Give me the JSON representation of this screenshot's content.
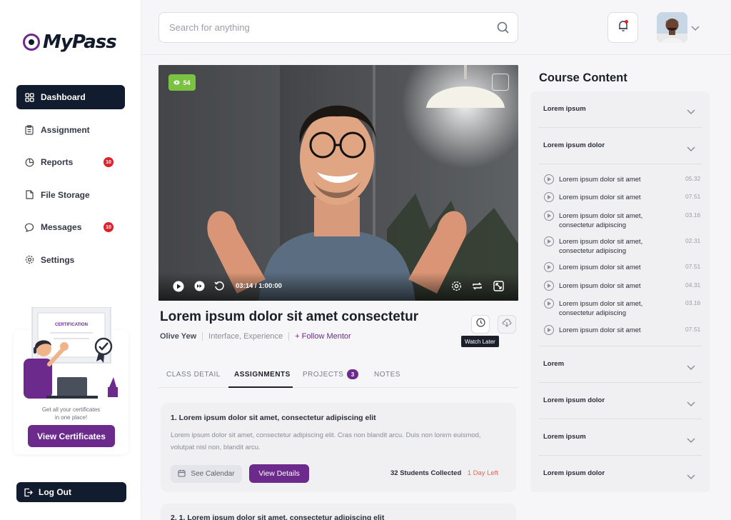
{
  "brand": {
    "name_prefix": "My",
    "name_suffix": "Pass"
  },
  "nav": {
    "items": [
      {
        "label": "Dashboard",
        "icon": "grid-icon",
        "badge": ""
      },
      {
        "label": "Assignment",
        "icon": "clipboard-icon",
        "badge": ""
      },
      {
        "label": "Reports",
        "icon": "pie-chart-icon",
        "badge": "10"
      },
      {
        "label": "File Storage",
        "icon": "file-icon",
        "badge": ""
      },
      {
        "label": "Messages",
        "icon": "chat-icon",
        "badge": "10"
      },
      {
        "label": "Settings",
        "icon": "gear-icon",
        "badge": ""
      }
    ],
    "active_index": 0
  },
  "certificates": {
    "badge_text": "CERTIFICATION",
    "line1": "Get all your certificates",
    "line2": "in one place!",
    "button": "View Certificates"
  },
  "logout": "Log Out",
  "search": {
    "placeholder": "Search for anything"
  },
  "video": {
    "views": "54",
    "time": "03:14 / 1:00:00"
  },
  "course": {
    "title": "Lorem ipsum dolor sit amet consectetur",
    "author": "Olive Yew",
    "tags": "Interface, Experience",
    "follow": "+ Follow Mentor",
    "tooltip": "Watch Later"
  },
  "tabs": [
    {
      "label": "CLASS DETAIL"
    },
    {
      "label": "ASSIGNMENTS"
    },
    {
      "label": "PROJECTS",
      "count": "3"
    },
    {
      "label": "NOTES"
    }
  ],
  "assignments": [
    {
      "title": "1. Lorem ipsum dolor sit amet, consectetur adipiscing elit",
      "desc": "Lorem ipsum dolor sit amet, consectetur adipiscing elit. Cras non blandit arcu. Duis non lorem euismod, volutpat nisl non, blandit arcu.",
      "calendar": "See Calendar",
      "details": "View Details",
      "collected": "32 Students Collected",
      "dot": "·",
      "left": "1 Day Left"
    },
    {
      "title": "2. 1. Lorem ipsum dolor sit amet, consectetur adipiscing elit"
    }
  ],
  "content": {
    "title": "Course Content",
    "sections_top": [
      "Lorem ipsum",
      "Lorem ipsum dolor"
    ],
    "lessons": [
      {
        "name": "Lorem ipsum dolor sit amet",
        "dur": "05.32"
      },
      {
        "name": "Lorem ipsum dolor sit amet",
        "dur": "07.51"
      },
      {
        "name": "Lorem ipsum dolor sit amet, consectetur adipiscing",
        "dur": "03.16"
      },
      {
        "name": "Lorem ipsum dolor sit amet, consectetur adipiscing",
        "dur": "02.31"
      },
      {
        "name": "Lorem ipsum dolor sit amet",
        "dur": "07.51"
      },
      {
        "name": "Lorem ipsum dolor sit amet",
        "dur": "04.31"
      },
      {
        "name": "Lorem ipsum dolor sit amet, consectetur adipiscing",
        "dur": "03.16"
      },
      {
        "name": "Lorem ipsum dolor sit amet",
        "dur": "07.51"
      }
    ],
    "sections_bottom": [
      "Lorem",
      "Lorem ipsum dolor",
      "Lorem ipsum",
      "Lorem ipsum dolor"
    ]
  },
  "colors": {
    "accent": "#6c2a8c",
    "nav_active": "#111c2f",
    "badge_red": "#e0202b",
    "views_green": "#7cc242",
    "days_left": "#e46a53"
  }
}
